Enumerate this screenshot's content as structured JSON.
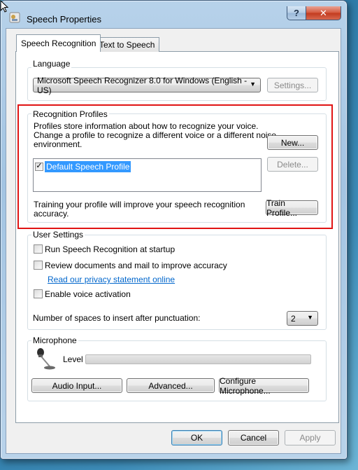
{
  "window": {
    "title": "Speech Properties",
    "help_glyph": "?",
    "close_glyph": "✕"
  },
  "tabs": [
    {
      "label": "Speech Recognition"
    },
    {
      "label": "Text to Speech"
    }
  ],
  "language": {
    "group_label": "Language",
    "recognizer_value": "Microsoft Speech Recognizer 8.0 for Windows (English - US)",
    "settings_label": "Settings..."
  },
  "profiles": {
    "group_label": "Recognition Profiles",
    "description_1": "Profiles store information about how to recognize your voice.",
    "description_2": "Change a profile to recognize a different voice or a different noise",
    "description_3": "environment.",
    "new_label": "New...",
    "delete_label": "Delete...",
    "items": [
      {
        "label": "Default Speech Profile",
        "checked": true
      }
    ],
    "training_text_1": "Training your profile will improve your speech recognition",
    "training_text_2": "accuracy.",
    "train_label": "Train Profile..."
  },
  "user_settings": {
    "group_label": "User Settings",
    "run_at_startup": "Run Speech Recognition at startup",
    "review_documents": "Review documents and mail to improve accuracy",
    "privacy_link": "Read our privacy statement online",
    "voice_activation": "Enable voice activation",
    "spaces_label": "Number of spaces to insert after punctuation:",
    "spaces_value": "2"
  },
  "microphone": {
    "group_label": "Microphone",
    "level_label": "Level",
    "level_value": 0,
    "audio_input_label": "Audio Input...",
    "advanced_label": "Advanced...",
    "configure_label": "Configure Microphone...",
    "icon": "microphone-icon"
  },
  "footer": {
    "ok_label": "OK",
    "cancel_label": "Cancel",
    "apply_label": "Apply"
  },
  "colors": {
    "highlight": "#e01414",
    "selection": "#3399ff",
    "link": "#0066cc"
  }
}
